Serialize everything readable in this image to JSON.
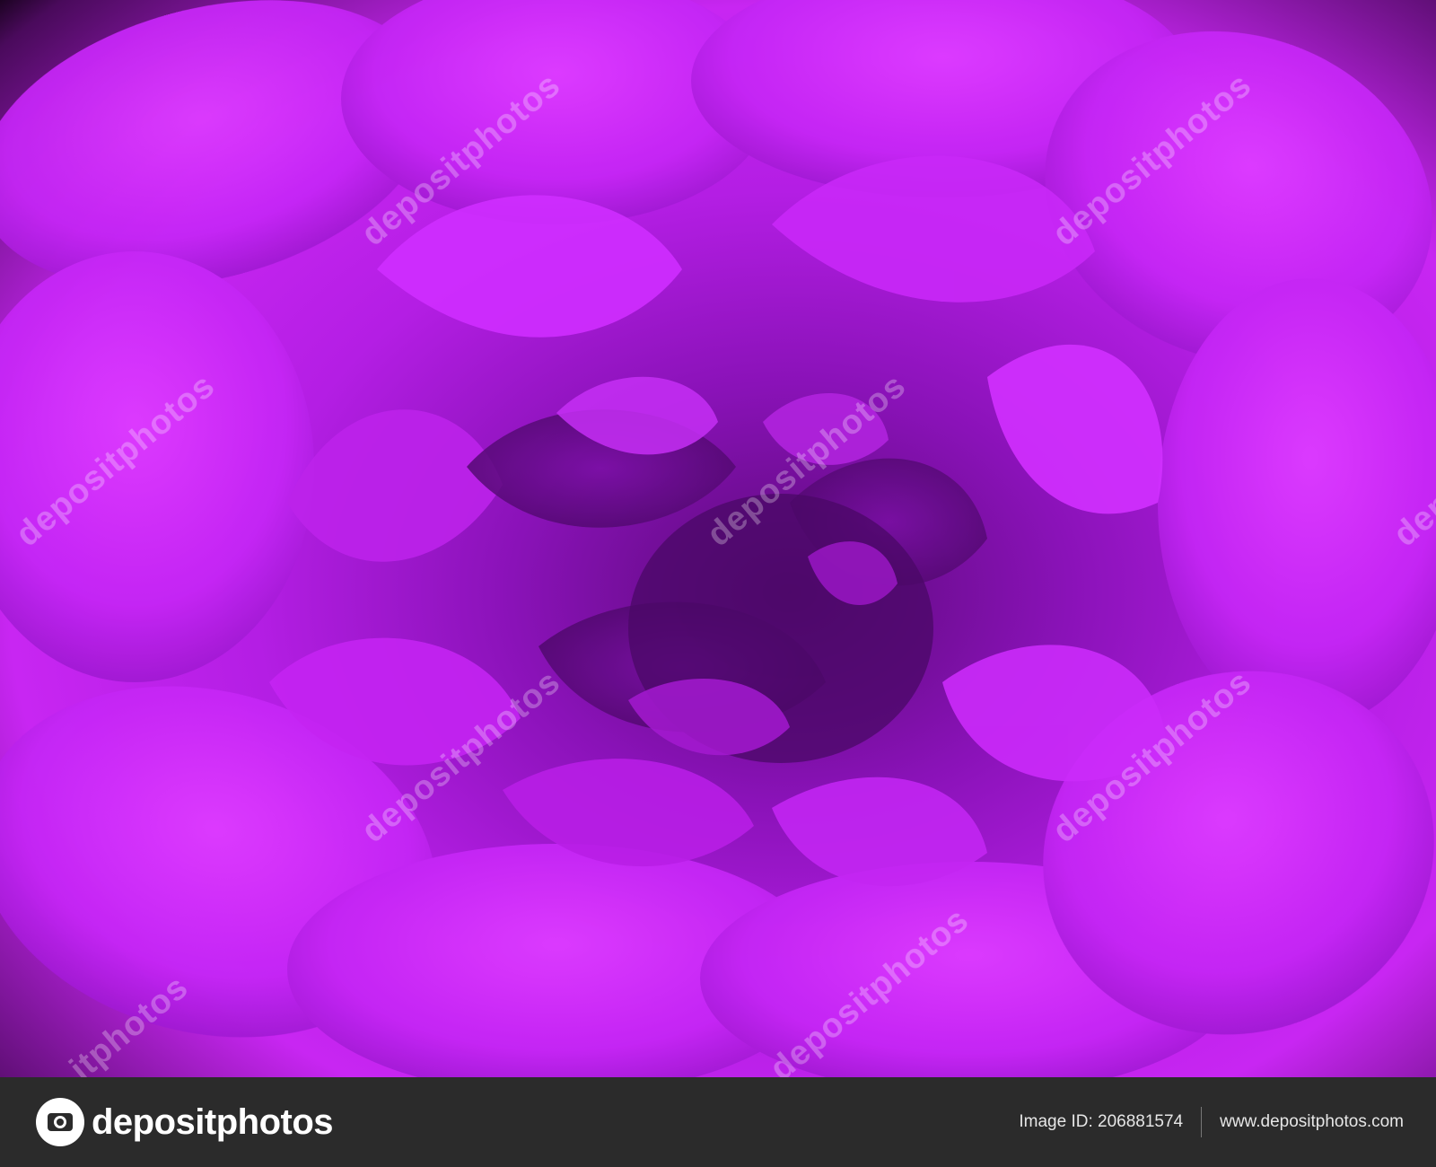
{
  "photo": {
    "subject": "magenta-peony-closeup",
    "colors": {
      "petal_light": "#d52cff",
      "petal_mid": "#b01fe0",
      "petal_dark": "#5c0a7a",
      "background": "#1c0322"
    },
    "watermarks": [
      "depositphotos",
      "depositphotos",
      "depositphotos",
      "depositphotos",
      "depositphotos",
      "depositphotos",
      "depositphotos",
      "itphotos",
      "depositphotos"
    ]
  },
  "footer": {
    "brand": "depositphotos",
    "image_id": "Image ID: 206881574",
    "site": "www.depositphotos.com"
  }
}
